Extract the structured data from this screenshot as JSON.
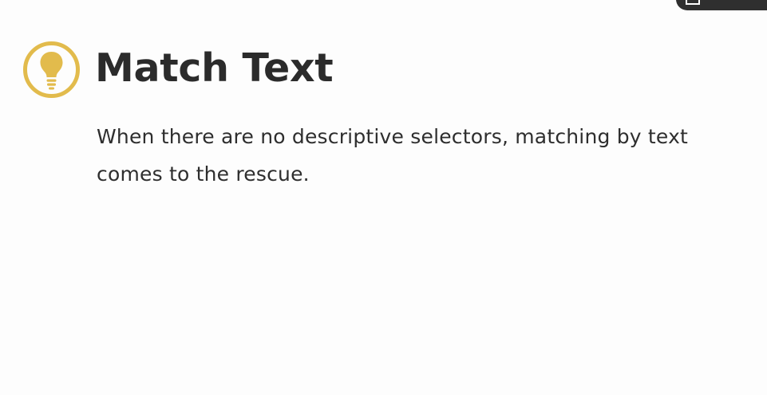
{
  "slide": {
    "title": "Match Text",
    "body": "When there are no descriptive selectors, matching by text comes to the rescue.",
    "icon": "lightbulb-icon"
  },
  "colors": {
    "accent": "#e2bb4c",
    "text": "#2b2b2b",
    "background": "#fdfdfd",
    "corner": "#2f2f2f"
  }
}
